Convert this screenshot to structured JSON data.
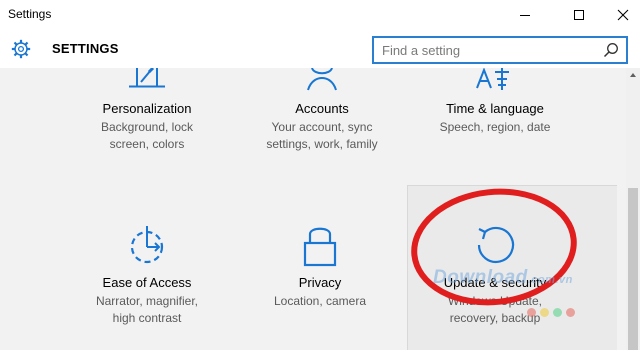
{
  "window": {
    "title": "Settings"
  },
  "header": {
    "title": "SETTINGS",
    "icon": "gear-icon"
  },
  "search": {
    "placeholder": "Find a setting",
    "value": "",
    "icon": "search-icon"
  },
  "tiles": [
    {
      "name": "Personalization",
      "desc1": "Background, lock",
      "desc2": "screen, colors",
      "icon": "personalization-icon"
    },
    {
      "name": "Accounts",
      "desc1": "Your account, sync",
      "desc2": "settings, work, family",
      "icon": "accounts-icon"
    },
    {
      "name": "Time & language",
      "desc1": "Speech, region, date",
      "desc2": "",
      "icon": "time-language-icon"
    },
    {
      "name": "Ease of Access",
      "desc1": "Narrator, magnifier,",
      "desc2": "high contrast",
      "icon": "ease-of-access-icon"
    },
    {
      "name": "Privacy",
      "desc1": "Location, camera",
      "desc2": "",
      "icon": "privacy-lock-icon"
    },
    {
      "name": "Update & security",
      "desc1": "Windows Update,",
      "desc2": "recovery, backup",
      "icon": "update-refresh-icon"
    }
  ],
  "watermark": {
    "text": "Download",
    "suffix": ".com.vn"
  },
  "colors": {
    "accent": "#2b7fd0",
    "icon_blue": "#1976d2",
    "annotation_red": "#e01e1e",
    "background": "#f2f2f2",
    "dots": [
      "#e74c3c",
      "#f1c40f",
      "#2ecc71",
      "#e74c3c"
    ]
  }
}
